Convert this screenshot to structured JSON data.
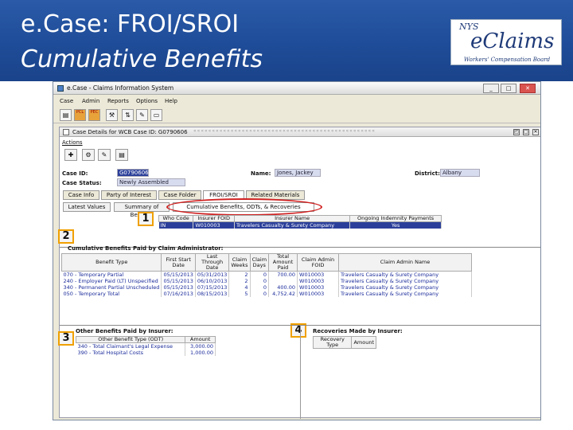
{
  "slide": {
    "title": "e.Case: FROI/SROI",
    "subtitle": "Cumulative Benefits"
  },
  "logo": {
    "nys": "NYS",
    "brand": "eClaims",
    "tagline": "Workers' Compensation Board"
  },
  "window": {
    "title": "e.Case - Claims Information System",
    "minimize": "_",
    "maximize": "□",
    "close": "✕"
  },
  "menu": [
    "Case",
    "Admin",
    "Reports",
    "Options",
    "Help"
  ],
  "toolbar": {
    "pcl": "PCL",
    "pec": "PEC"
  },
  "panel": {
    "title": "Case Details for WCB Case ID: G0790606",
    "actions_label": "Actions"
  },
  "case": {
    "case_id_label": "Case ID:",
    "case_id": "G0790606",
    "status_label": "Case Status:",
    "status": "Newly Assembled",
    "name_label": "Name:",
    "name": "Jones, Jackey",
    "district_label": "District:",
    "district": "Albany"
  },
  "tabs": [
    "Case Info",
    "Party of Interest",
    "Case Folder",
    "FROI/SROI",
    "Related Materials"
  ],
  "subtabs": [
    "Latest Values",
    "Summary of Benefits",
    "Cumulative Benefits, ODTs, & Recoveries"
  ],
  "callouts": [
    "1",
    "2",
    "3",
    "4"
  ],
  "insurer_table": {
    "headers": [
      "Who Code",
      "Insurer FOID",
      "Insurer Name",
      "Ongoing Indemnity Payments"
    ],
    "rows": [
      [
        "IN",
        "W010003",
        "Travelers Casualty & Surety Company",
        "Yes"
      ]
    ]
  },
  "cumulative": {
    "title": "Cumulative Benefits Paid by Claim Administrator:",
    "headers": [
      "Benefit Type",
      "First Start Date",
      "Last Through Date",
      "Claim Weeks",
      "Claim Days",
      "Total Amount Paid",
      "Claim Admin FOID",
      "Claim Admin Name"
    ],
    "rows": [
      [
        "070 - Temporary Partial",
        "05/15/2013",
        "05/31/2013",
        "2",
        "0",
        "700.00",
        "W010003",
        "Travelers Casualty & Surety Company"
      ],
      [
        "240 - Employer Paid (LT) Unspecified",
        "05/15/2013",
        "06/10/2013",
        "2",
        "0",
        "",
        "W010003",
        "Travelers Casualty & Surety Company"
      ],
      [
        "340 - Permanent Partial Unscheduled",
        "05/15/2013",
        "07/15/2013",
        "4",
        "0",
        "400.00",
        "W010003",
        "Travelers Casualty & Surety Company"
      ],
      [
        "050 - Temporary Total",
        "07/16/2013",
        "08/15/2013",
        "5",
        "0",
        "4,752.42",
        "W010003",
        "Travelers Casualty & Surety Company"
      ]
    ]
  },
  "other_benefits": {
    "title": "Other Benefits Paid by Insurer:",
    "headers": [
      "Other Benefit Type (ODT)",
      "Amount"
    ],
    "rows": [
      [
        "340 - Total Claimant's Legal Expense",
        "3,000.00"
      ],
      [
        "390 - Total Hospital Costs",
        "1,000.00"
      ]
    ]
  },
  "recoveries": {
    "title": "Recoveries Made by Insurer:",
    "headers": [
      "Recovery Type",
      "Amount"
    ]
  }
}
